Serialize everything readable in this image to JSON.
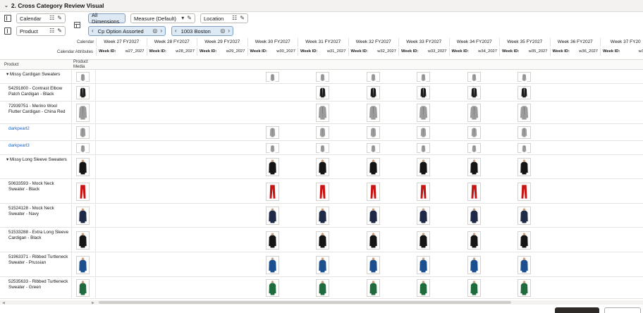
{
  "title": "2. Cross Category Review Visual",
  "filters": {
    "calendar": "Calendar",
    "product": "Product",
    "all_dimensions": "All Dimensions",
    "measure": "Measure (Default)",
    "location": "Location",
    "option_assorted": "Cp Option Assorted",
    "store": "1003 Boston"
  },
  "header": {
    "calendar_label": "Calendar",
    "calendar_attributes_label": "Calendar Attributes",
    "product_label": "Product",
    "product_media_label": "Product Media",
    "weeks": [
      {
        "label": "Week 27 FY2027",
        "id_label": "Week ID:",
        "id": "w27_2027"
      },
      {
        "label": "Week 28 FY2027",
        "id_label": "Week ID:",
        "id": "w28_2027"
      },
      {
        "label": "Week 29 FY2027",
        "id_label": "Week ID:",
        "id": "w29_2027"
      },
      {
        "label": "Week 30 FY2027",
        "id_label": "Week ID:",
        "id": "w30_2027"
      },
      {
        "label": "Week 31 FY2027",
        "id_label": "Week ID:",
        "id": "w31_2027"
      },
      {
        "label": "Week 32 FY2027",
        "id_label": "Week ID:",
        "id": "w32_2027"
      },
      {
        "label": "Week 33 FY2027",
        "id_label": "Week ID:",
        "id": "w33_2027"
      },
      {
        "label": "Week 34 FY2027",
        "id_label": "Week ID:",
        "id": "w34_2027"
      },
      {
        "label": "Week 35 FY2027",
        "id_label": "Week ID:",
        "id": "w35_2027"
      },
      {
        "label": "Week 36 FY2027",
        "id_label": "Week ID:",
        "id": "w36_2027"
      },
      {
        "label": "Week 37 FY20",
        "id_label": "Week ID:",
        "id": "w37_"
      }
    ]
  },
  "rows": [
    {
      "name": "Missy Cardigan Sweaters",
      "group": true,
      "link": false,
      "garment": "cardigan-gray",
      "weeks": [
        3,
        4,
        5,
        6,
        7,
        8
      ]
    },
    {
      "name": "54291800 - Contrast Elbow Patch Cardigan - Black",
      "group": false,
      "link": false,
      "garment": "cardigan-black",
      "weeks": [
        4,
        5,
        6,
        7,
        8
      ]
    },
    {
      "name": "72939751 - Merino Wool Flutter Cardigan - China Red",
      "group": false,
      "link": false,
      "garment": "cardigan-gray",
      "weeks": [
        4,
        5,
        6,
        7,
        8
      ]
    },
    {
      "name": "darkpearl2",
      "group": false,
      "link": true,
      "garment": "cardigan-gray",
      "weeks": [
        3,
        4,
        5,
        6,
        7,
        8
      ]
    },
    {
      "name": "darkpearl3",
      "group": false,
      "link": true,
      "garment": "cardigan-gray",
      "weeks": [
        3,
        4,
        5,
        6,
        7,
        8
      ]
    },
    {
      "name": "Missy Long Sleeve Sweaters",
      "group": true,
      "link": false,
      "garment": "sweater-black",
      "weeks": [
        3,
        4,
        5,
        6,
        7,
        8
      ]
    },
    {
      "name": "50633593 - Mock Neck Sweater - Black",
      "group": false,
      "link": false,
      "garment": "pants-red",
      "weeks": [
        3,
        4,
        5,
        6,
        7,
        8
      ]
    },
    {
      "name": "51524128 - Mock Neck Sweater - Navy",
      "group": false,
      "link": false,
      "garment": "sweater-navy",
      "weeks": [
        3,
        4,
        5,
        6,
        7,
        8
      ]
    },
    {
      "name": "51533288 - Extra Long Sleeve Cardigan - Black",
      "group": false,
      "link": false,
      "garment": "sweater-black",
      "weeks": [
        3,
        4,
        5,
        6,
        7,
        8
      ]
    },
    {
      "name": "51963371 - Ribbed Turtleneck Sweater - Prussian",
      "group": false,
      "link": false,
      "garment": "sweater-blue",
      "weeks": [
        3,
        4,
        5,
        6,
        7,
        8
      ]
    },
    {
      "name": "52535633 - Ribbed Turtleneck Sweater - Green",
      "group": false,
      "link": false,
      "garment": "sweater-green",
      "weeks": [
        3,
        4,
        5,
        6,
        7,
        8
      ]
    }
  ],
  "colors": {
    "link": "#1a63c4",
    "highlight": "#ddeaf6"
  }
}
